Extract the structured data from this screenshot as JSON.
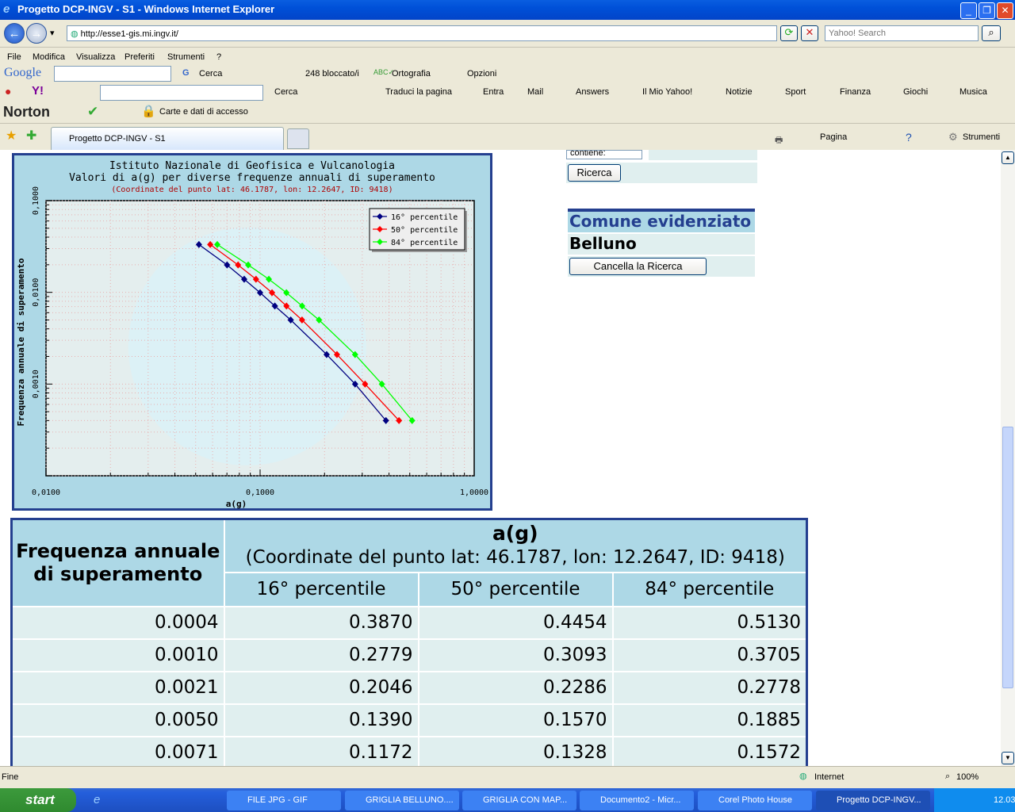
{
  "window": {
    "title": "Progetto DCP-INGV - S1 - Windows Internet Explorer"
  },
  "address": {
    "url": "http://esse1-gis.mi.ingv.it/",
    "search_placeholder": "Yahoo! Search"
  },
  "menu": [
    "File",
    "Modifica",
    "Visualizza",
    "Preferiti",
    "Strumenti",
    "?"
  ],
  "google_bar": {
    "brand": "Google",
    "search": "Cerca",
    "blocked": "248 bloccato/i",
    "spell": "Ortografia",
    "options": "Opzioni"
  },
  "yahoo_bar": {
    "search": "Cerca",
    "translate": "Traduci la pagina",
    "enter": "Entra",
    "mail": "Mail",
    "answers": "Answers",
    "my_yahoo": "Il Mio Yahoo!",
    "news": "Notizie",
    "sport": "Sport",
    "finance": "Finanza",
    "games": "Giochi",
    "music": "Musica"
  },
  "norton_bar": {
    "brand": "Norton",
    "cards": "Carte e dati di accesso"
  },
  "tabs": {
    "active": "Progetto DCP-INGV - S1",
    "page": "Pagina",
    "tools": "Strumenti"
  },
  "side": {
    "contains": "contiene:",
    "search_btn": "Ricerca",
    "heading": "Comune evidenziato",
    "comune": "Belluno",
    "clear_btn": "Cancella la Ricerca"
  },
  "chart_data": {
    "type": "line",
    "title": "Istituto Nazionale di Geofisica e Vulcanologia",
    "subtitle": "Valori di a(g) per diverse frequenze annuali di superamento",
    "caption": "(Coordinate del punto lat: 46.1787, lon: 12.2647, ID: 9418)",
    "xlabel": "a(g)",
    "ylabel": "Frequenza annuale di superamento",
    "xscale": "log",
    "yscale": "log",
    "xlim": [
      0.01,
      1
    ],
    "ylim": [
      0.0001,
      0.1
    ],
    "xticks": [
      "0,0100",
      "0,1000",
      "1,0000"
    ],
    "yticks": [
      "0,1000",
      "0,0100",
      "0,0010"
    ],
    "grid": true,
    "legend": "top-right",
    "y": [
      0.0332,
      0.0199,
      0.0139,
      0.0099,
      0.0071,
      0.005,
      0.0021,
      0.001,
      0.0004
    ],
    "series": [
      {
        "name": "16° percentile",
        "color": "#000080",
        "x": [
          0.0518,
          0.0701,
          0.0843,
          0.1,
          0.1172,
          0.139,
          0.2046,
          0.2779,
          0.387
        ]
      },
      {
        "name": "50° percentile",
        "color": "#ff0000",
        "x": [
          0.0585,
          0.0789,
          0.0957,
          0.1137,
          0.1328,
          0.157,
          0.2286,
          0.3093,
          0.4454
        ]
      },
      {
        "name": "84° percentile",
        "color": "#00ff00",
        "x": [
          0.0631,
          0.088,
          0.1099,
          0.1327,
          0.1572,
          0.1885,
          0.2778,
          0.3705,
          0.513
        ]
      }
    ]
  },
  "table": {
    "row_header": "Frequenza annuale di superamento",
    "col_header": "a(g)",
    "col_sub": "(Coordinate del punto lat: 46.1787, lon: 12.2647, ID: 9418)",
    "percentiles": [
      "16° percentile",
      "50° percentile",
      "84° percentile"
    ],
    "rows": [
      [
        "0.0004",
        "0.3870",
        "0.4454",
        "0.5130"
      ],
      [
        "0.0010",
        "0.2779",
        "0.3093",
        "0.3705"
      ],
      [
        "0.0021",
        "0.2046",
        "0.2286",
        "0.2778"
      ],
      [
        "0.0050",
        "0.1390",
        "0.1570",
        "0.1885"
      ],
      [
        "0.0071",
        "0.1172",
        "0.1328",
        "0.1572"
      ]
    ]
  },
  "status": {
    "text": "Fine",
    "zone": "Internet",
    "zoom": "100%"
  },
  "taskbar": {
    "start": "start",
    "tasks": [
      "FILE JPG - GIF",
      "GRIGLIA BELLUNO....",
      "GRIGLIA CON MAP...",
      "Documento2 - Micr...",
      "Corel Photo House",
      "Progetto DCP-INGV..."
    ],
    "clock": "12.03"
  }
}
